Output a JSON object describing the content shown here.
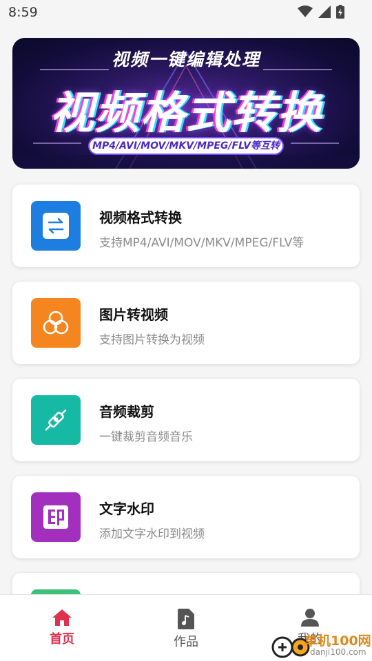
{
  "status_bar": {
    "time": "8:59"
  },
  "banner": {
    "subtitle": "视频一键编辑处理",
    "title": "视频格式转换",
    "pill": "MP4/AVI/MOV/MKV/MPEG/FLV等互转"
  },
  "features": [
    {
      "title": "视频格式转换",
      "desc": "支持MP4/AVI/MOV/MKV/MPEG/FLV等",
      "icon": "convert-arrows-icon",
      "color": "#1e7ee0"
    },
    {
      "title": "图片转视频",
      "desc": "支持图片转换为视频",
      "icon": "three-circles-icon",
      "color": "#f5861f"
    },
    {
      "title": "音频裁剪",
      "desc": "一键裁剪音频音乐",
      "icon": "plug-icon",
      "color": "#15b9a4"
    },
    {
      "title": "文字水印",
      "desc": "添加文字水印到视频",
      "icon": "stamp-icon",
      "color": "#a22fbd"
    },
    {
      "icon": "partial-icon",
      "color": "#3cc07a"
    }
  ],
  "bottom_nav": {
    "items": [
      {
        "label": "首页",
        "icon": "home-icon",
        "active": true
      },
      {
        "label": "作品",
        "icon": "music-file-icon",
        "active": false
      },
      {
        "label": "我的",
        "icon": "user-icon",
        "active": false
      }
    ],
    "active_color": "#e0314f",
    "inactive_color": "#555555"
  },
  "watermark": {
    "text": "单机100网",
    "url": "danji100.com"
  }
}
